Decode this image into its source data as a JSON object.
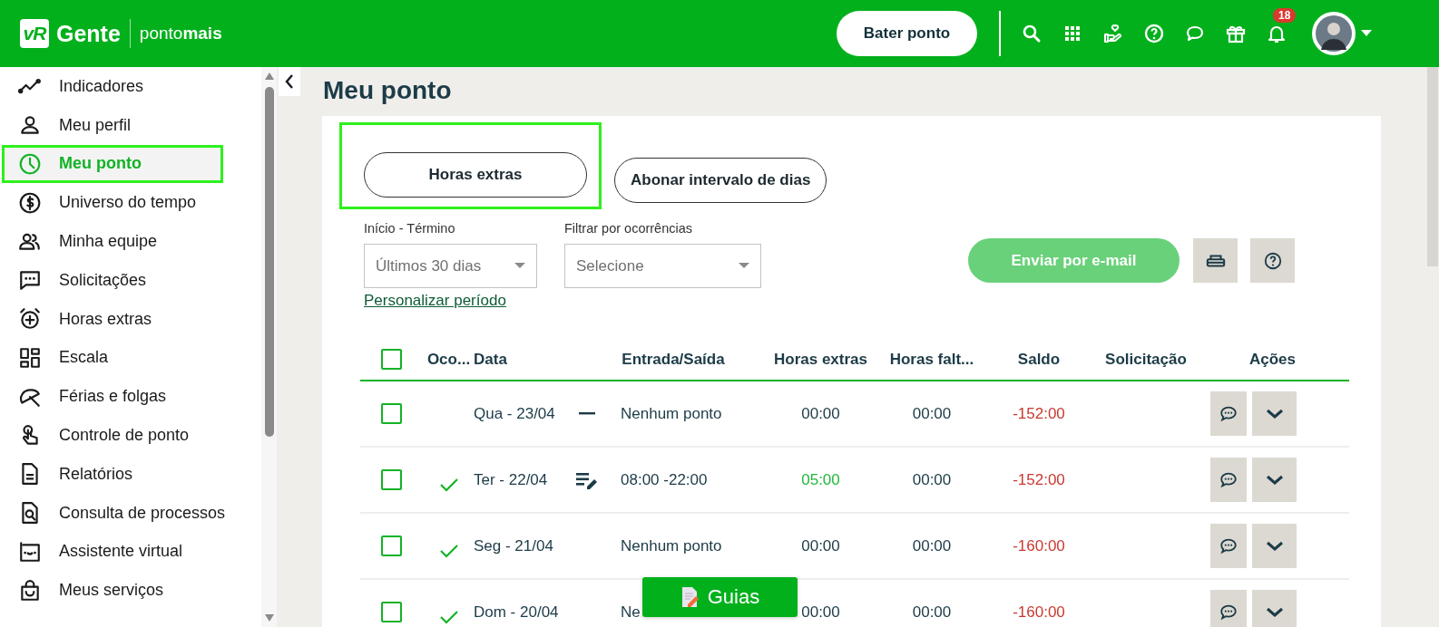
{
  "header": {
    "logo_mark": "vR",
    "logo_name": "Gente",
    "product": "ponto**mais**",
    "clock_in_button": "Bater ponto",
    "notification_count": "18"
  },
  "sidebar": {
    "items": [
      {
        "label": "Indicadores",
        "selected": false
      },
      {
        "label": "Meu perfil",
        "selected": false
      },
      {
        "label": "Meu ponto",
        "selected": true
      },
      {
        "label": "Universo do tempo",
        "selected": false
      },
      {
        "label": "Minha equipe",
        "selected": false
      },
      {
        "label": "Solicitações",
        "selected": false
      },
      {
        "label": "Horas extras",
        "selected": false
      },
      {
        "label": "Escala",
        "selected": false
      },
      {
        "label": "Férias e folgas",
        "selected": false
      },
      {
        "label": "Controle de ponto",
        "selected": false
      },
      {
        "label": "Relatórios",
        "selected": false
      },
      {
        "label": "Consulta de processos",
        "selected": false
      },
      {
        "label": "Assistente virtual",
        "selected": false
      },
      {
        "label": "Meus serviços",
        "selected": false
      }
    ]
  },
  "page": {
    "title": "Meu ponto"
  },
  "actions": [
    {
      "label": "Horas extras",
      "highlighted": true
    },
    {
      "label": "Abonar intervalo de dias",
      "highlighted": false
    }
  ],
  "filters": {
    "period_label": "Início - Término",
    "period_value": "Últimos 30 dias",
    "period_link": "Personalizar período",
    "occurrence_label": "Filtrar por ocorrências",
    "occurrence_placeholder": "Selecione"
  },
  "email_button": {
    "label": "Enviar por e-mail",
    "disabled": true
  },
  "table": {
    "columns": [
      "Oco...",
      "Data",
      "Entrada/Saída",
      "Horas extras",
      "Horas falt...",
      "Saldo",
      "Solicitação",
      "Ações"
    ],
    "select_all_checked": false,
    "rows": [
      {
        "checked": false,
        "ok": false,
        "date": "Qua - 23/04",
        "kind": "dash",
        "entries": "Nenhum ponto",
        "extra": "00:00",
        "extra_positive": false,
        "missing": "00:00",
        "balance": "-152:00",
        "balance_negative": true
      },
      {
        "checked": false,
        "ok": true,
        "date": "Ter - 22/04",
        "kind": "edited",
        "entries": "08:00 -22:00",
        "extra": "05:00",
        "extra_positive": true,
        "missing": "00:00",
        "balance": "-152:00",
        "balance_negative": true
      },
      {
        "checked": false,
        "ok": true,
        "date": "Seg - 21/04",
        "kind": "plain",
        "entries": "Nenhum ponto",
        "extra": "00:00",
        "extra_positive": false,
        "missing": "00:00",
        "balance": "-160:00",
        "balance_negative": true
      },
      {
        "checked": false,
        "ok": true,
        "date": "Dom - 20/04",
        "kind": "plain",
        "entries": "Ne",
        "extra": "00:00",
        "extra_positive": false,
        "missing": "00:00",
        "balance": "-160:00",
        "balance_negative": true
      }
    ]
  },
  "guides_button": "Guias"
}
